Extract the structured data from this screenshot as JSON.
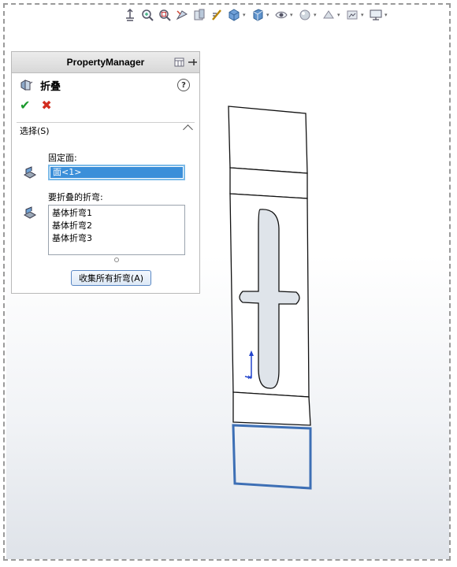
{
  "property_manager": {
    "title": "PropertyManager",
    "feature_name": "折叠",
    "help_label": "?",
    "ok_label": "✔",
    "cancel_label": "✖",
    "selections": {
      "group_title": "选择(S)",
      "fixed_face_label": "固定面:",
      "fixed_face_value": "面<1>",
      "bends_label": "要折叠的折弯:",
      "bends": [
        "基体折弯1",
        "基体折弯2",
        "基体折弯3"
      ],
      "collect_button": "收集所有折弯(A)"
    }
  },
  "toolbar": {
    "icons": [
      "normal-to-icon",
      "zoom-to-fit-icon",
      "zoom-area-icon",
      "previous-view-icon",
      "section-view-icon",
      "dynamic-annotation-icon",
      "view-orientation-icon",
      "display-style-icon",
      "hide-show-items-icon",
      "edit-appearance-icon",
      "apply-scene-icon",
      "view-settings-icon",
      "display-monitor-icon"
    ]
  },
  "colors": {
    "accent_selection": "#3b8fd9",
    "fixed_face_edge": "#3d6fb5",
    "ok_green": "#1c9a2e",
    "cancel_red": "#d22d1f"
  }
}
